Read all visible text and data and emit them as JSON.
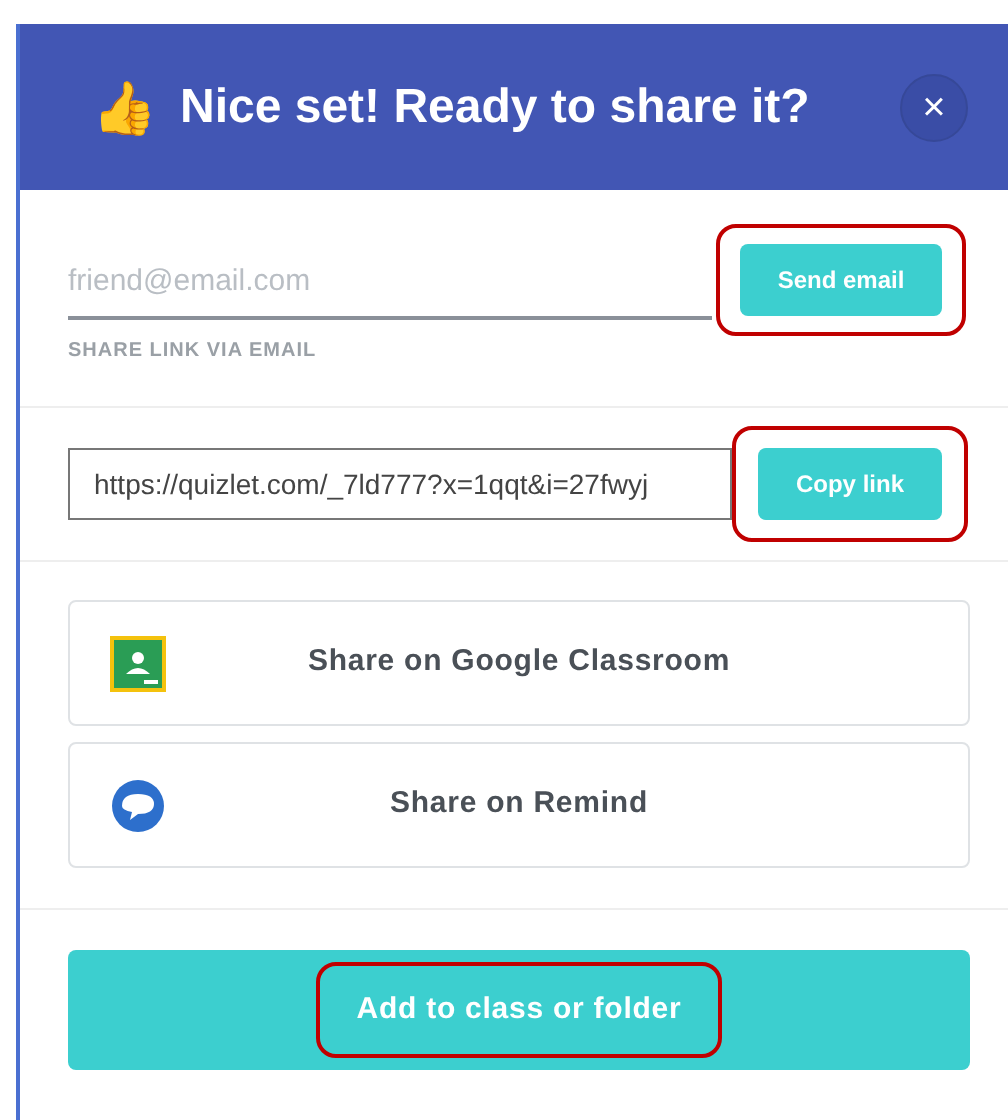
{
  "header": {
    "emoji": "👍",
    "title": "Nice set! Ready to share it?",
    "close": "×"
  },
  "email": {
    "placeholder": "friend@email.com",
    "label": "SHARE LINK VIA EMAIL",
    "button": {
      "label": "Send email",
      "highlighted": true
    }
  },
  "link": {
    "value": "https://quizlet.com/_7ld777?x=1qqt&i=27fwyj",
    "button": {
      "label": "Copy link",
      "highlighted": true
    }
  },
  "share_buttons": [
    {
      "kind": "classroom",
      "label": "Share on Google Classroom"
    },
    {
      "kind": "remind",
      "label": "Share on Remind"
    }
  ],
  "add_button": {
    "label": "Add to class or folder",
    "highlighted": true
  }
}
